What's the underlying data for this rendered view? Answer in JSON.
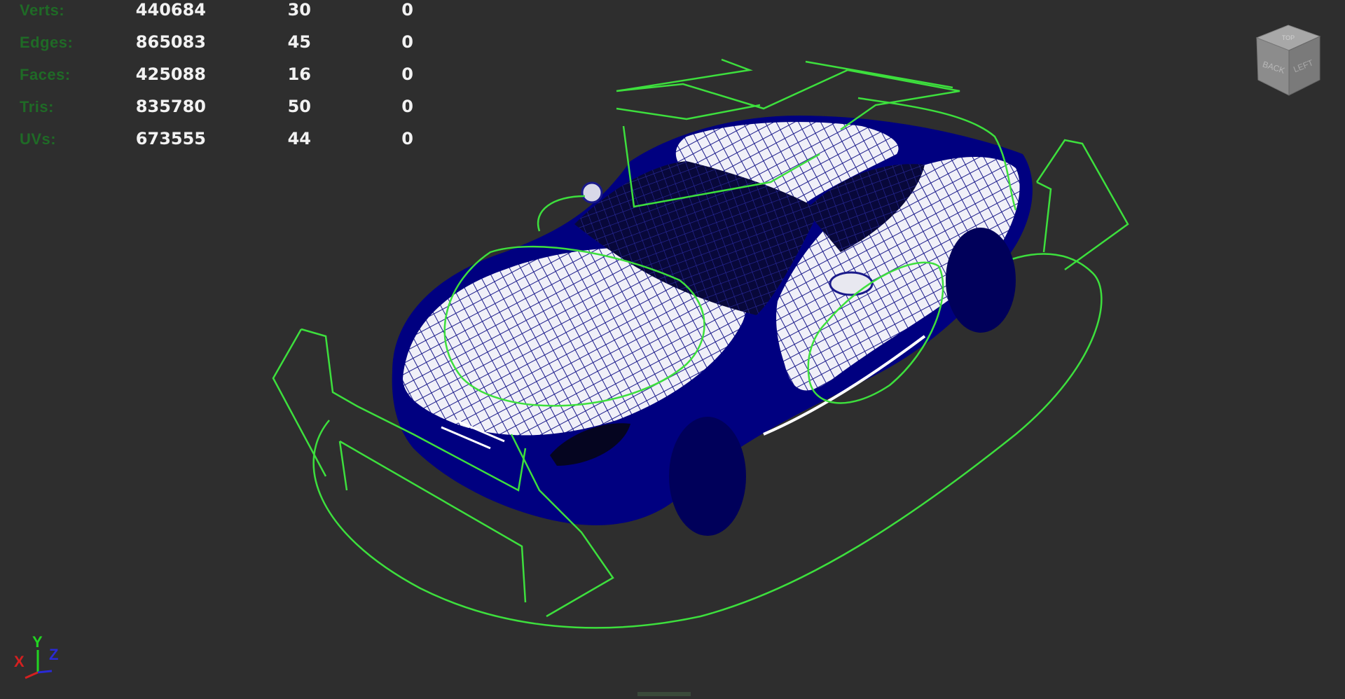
{
  "hud": {
    "rows": [
      {
        "label": "Verts:",
        "total": "440684",
        "selected": "30",
        "faces_sel": "0"
      },
      {
        "label": "Edges:",
        "total": "865083",
        "selected": "45",
        "faces_sel": "0"
      },
      {
        "label": "Faces:",
        "total": "425088",
        "selected": "16",
        "faces_sel": "0"
      },
      {
        "label": "Tris:",
        "total": "835780",
        "selected": "50",
        "faces_sel": "0"
      },
      {
        "label": "UVs:",
        "total": "673555",
        "selected": "44",
        "faces_sel": "0"
      }
    ]
  },
  "viewcube": {
    "faces": [
      "BACK",
      "LEFT",
      "TOP"
    ]
  },
  "axis": {
    "x": "X",
    "y": "Y",
    "z": "Z",
    "colors": {
      "x": "#d42020",
      "y": "#22d422",
      "z": "#2a2ad4"
    }
  },
  "colors": {
    "background": "#2e2e2e",
    "wireframe_body": "#000080",
    "wireframe_highlight": "#ffffff",
    "nurbs_curves": "#3ddf3d"
  }
}
